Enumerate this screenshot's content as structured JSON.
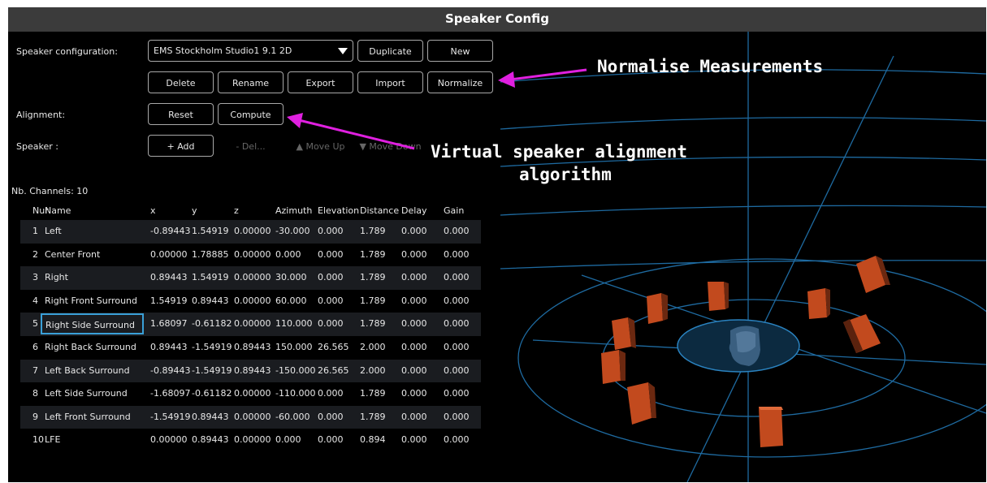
{
  "title": "Speaker Config",
  "labels": {
    "speaker_configuration": "Speaker configuration:",
    "alignment": "Alignment:",
    "speaker": "Speaker :",
    "nb_channels": "Nb. Channels: 10"
  },
  "config_select": {
    "value": "EMS Stockholm Studio1 9.1 2D"
  },
  "buttons": {
    "duplicate": "Duplicate",
    "new": "New",
    "delete": "Delete",
    "rename": "Rename",
    "export": "Export",
    "import": "Import",
    "normalize": "Normalize",
    "reset": "Reset",
    "compute": "Compute",
    "add": "+ Add",
    "del": "- Del...",
    "move_up": "▲ Move Up",
    "move_down": "▼ Move Down"
  },
  "table": {
    "headers": [
      "Nur",
      "Name",
      "x",
      "y",
      "z",
      "Azimuth",
      "Elevation",
      "Distance",
      "Delay",
      "Gain"
    ],
    "rows": [
      [
        "1",
        "Left",
        "-0.89443",
        "1.54919",
        "0.00000",
        "-30.000",
        "0.000",
        "1.789",
        "0.000",
        "0.000"
      ],
      [
        "2",
        "Center Front",
        "0.00000",
        "1.78885",
        "0.00000",
        "0.000",
        "0.000",
        "1.789",
        "0.000",
        "0.000"
      ],
      [
        "3",
        "Right",
        "0.89443",
        "1.54919",
        "0.00000",
        "30.000",
        "0.000",
        "1.789",
        "0.000",
        "0.000"
      ],
      [
        "4",
        "Right Front Surround",
        "1.54919",
        "0.89443",
        "0.00000",
        "60.000",
        "0.000",
        "1.789",
        "0.000",
        "0.000"
      ],
      [
        "5",
        "Right Side Surround",
        "1.68097",
        "-0.61182",
        "0.00000",
        "110.000",
        "0.000",
        "1.789",
        "0.000",
        "0.000"
      ],
      [
        "6",
        "Right Back Surround",
        "0.89443",
        "-1.54919",
        "0.89443",
        "150.000",
        "26.565",
        "2.000",
        "0.000",
        "0.000"
      ],
      [
        "7",
        "Left Back Surround",
        "-0.89443",
        "-1.54919",
        "0.89443",
        "-150.000",
        "26.565",
        "2.000",
        "0.000",
        "0.000"
      ],
      [
        "8",
        "Left Side Surround",
        "-1.68097",
        "-0.61182",
        "0.00000",
        "-110.000",
        "0.000",
        "1.789",
        "0.000",
        "0.000"
      ],
      [
        "9",
        "Left Front Surround",
        "-1.54919",
        "0.89443",
        "0.00000",
        "-60.000",
        "0.000",
        "1.789",
        "0.000",
        "0.000"
      ],
      [
        "10",
        "LFE",
        "0.00000",
        "0.89443",
        "0.00000",
        "0.000",
        "0.000",
        "0.894",
        "0.000",
        "0.000"
      ]
    ]
  },
  "annotations": {
    "normalise": "Normalise Measurements",
    "virtual_line1": "Virtual speaker alignment",
    "virtual_line2": "algorithm"
  },
  "colors": {
    "titlebar": "#3b3b3b",
    "grid": "#1e6aa0",
    "speaker_orange": "#c24a1e",
    "annotation_arrow": "#e020e0",
    "selection": "#3aa0d8"
  },
  "icons": {
    "dropdown": "caret-down-icon",
    "head": "listener-head-icon",
    "speaker": "loudspeaker-icon"
  }
}
